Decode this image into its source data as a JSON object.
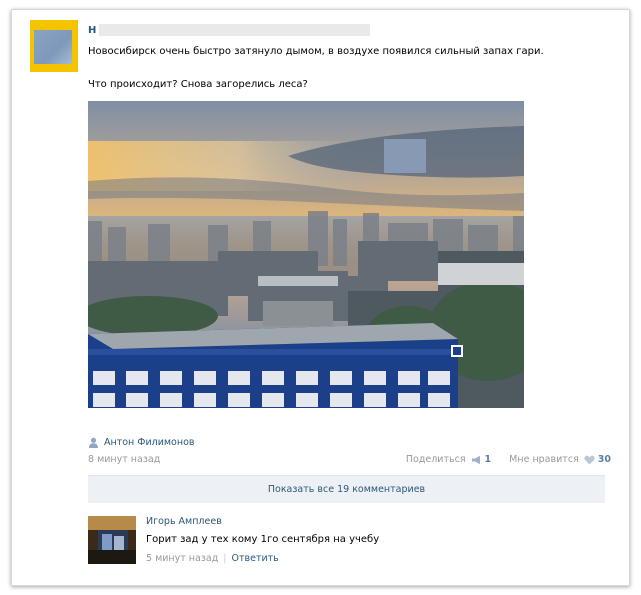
{
  "post": {
    "author_initial": "Н",
    "text_line1": "Новосибирск очень быстро затянуло дымом, в воздухе появился сильный запах гари.",
    "text_line2": "Что происходит? Снова загорелись леса?",
    "photo_icon": "city-smoke-photo"
  },
  "meta": {
    "author": "Антон Филимонов",
    "time": "8 минут назад",
    "share_label": "Поделиться",
    "share_count": "1",
    "like_label": "Мне нравится",
    "like_count": "30"
  },
  "comments": {
    "show_all_label": "Показать все 19 комментариев",
    "items": [
      {
        "author": "Игорь Амплеев",
        "text": "Горит зад у тех кому 1го сентября на учебу",
        "time": "5 минут назад",
        "reply_label": "Ответить"
      }
    ]
  },
  "colors": {
    "link": "#2b587a",
    "muted": "#999999",
    "button_bg": "#edf1f5",
    "avatar_bg": "#f5c400"
  }
}
